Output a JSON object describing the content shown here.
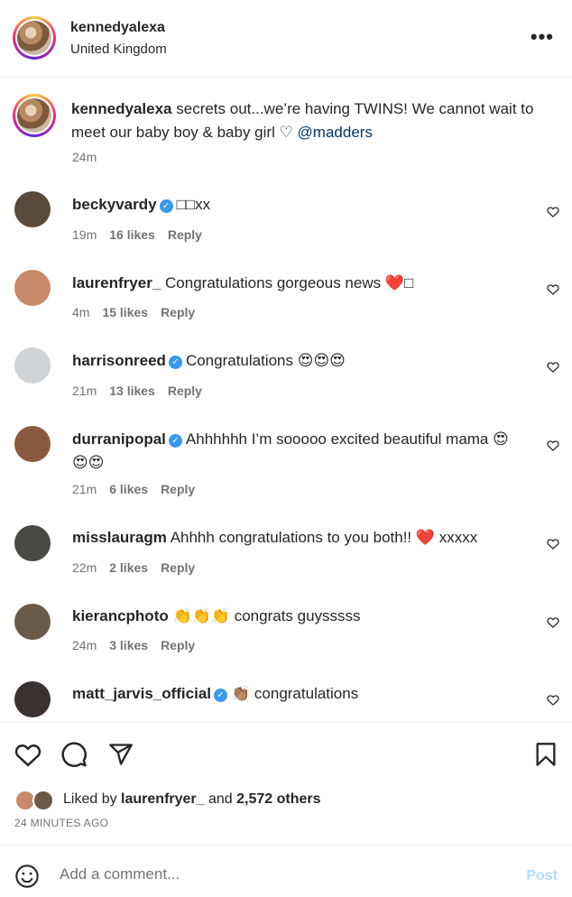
{
  "header": {
    "username": "kennedyalexa",
    "location": "United Kingdom",
    "more_label": "•••"
  },
  "caption": {
    "username": "kennedyalexa",
    "text": " secrets out...we’re having TWINS! We cannot wait to meet our baby boy & baby girl ♡ ",
    "mention": "@madders",
    "time": "24m"
  },
  "comments": [
    {
      "username": "beckyvardy",
      "verified": true,
      "text": "□□xx",
      "time": "19m",
      "likes": "16 likes",
      "reply": "Reply",
      "avatar_color": "#5a4a3a"
    },
    {
      "username": "laurenfryer_",
      "verified": false,
      "text": "Congratulations gorgeous news ❤️□",
      "time": "4m",
      "likes": "15 likes",
      "reply": "Reply",
      "avatar_color": "#c78a6a"
    },
    {
      "username": "harrisonreed",
      "verified": true,
      "text": "Congratulations 😍😍😍",
      "time": "21m",
      "likes": "13 likes",
      "reply": "Reply",
      "avatar_color": "#cfd3d6"
    },
    {
      "username": "durranipopal",
      "verified": true,
      "text": "Ahhhhhh I’m sooooo excited beautiful mama 😍😍😍",
      "time": "21m",
      "likes": "6 likes",
      "reply": "Reply",
      "avatar_color": "#8a5a3e"
    },
    {
      "username": "misslauragm",
      "verified": false,
      "text": "Ahhhh congratulations to you both!! ❤️ xxxxx",
      "time": "22m",
      "likes": "2 likes",
      "reply": "Reply",
      "avatar_color": "#4a4a44"
    },
    {
      "username": "kierancphoto",
      "verified": false,
      "text": "👏👏👏 congrats guysssss",
      "time": "24m",
      "likes": "3 likes",
      "reply": "Reply",
      "avatar_color": "#6b5a48"
    },
    {
      "username": "matt_jarvis_official",
      "verified": true,
      "text": "👏🏽 congratulations",
      "time": "",
      "likes": "",
      "reply": "",
      "avatar_color": "#3a3230"
    }
  ],
  "footer": {
    "liked_by_prefix": "Liked by ",
    "liked_by_user": "laurenfryer_",
    "liked_by_middle": " and ",
    "liked_by_count": "2,572 others",
    "time_ago": "24 MINUTES AGO"
  },
  "add_comment": {
    "placeholder": "Add a comment...",
    "post_label": "Post"
  },
  "icons": {
    "like": "heart-icon",
    "comment": "comment-icon",
    "share": "share-icon",
    "save": "bookmark-icon",
    "emoji": "smile-icon"
  }
}
